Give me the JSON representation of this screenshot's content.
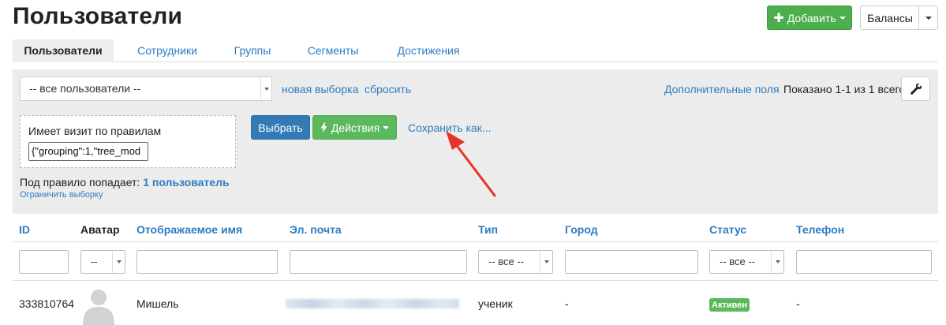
{
  "header": {
    "title": "Пользователи",
    "add_button": "Добавить",
    "balance_button": "Балансы"
  },
  "tabs": [
    {
      "label": "Пользователи",
      "active": true
    },
    {
      "label": "Сотрудники"
    },
    {
      "label": "Группы"
    },
    {
      "label": "Сегменты"
    },
    {
      "label": "Достижения"
    }
  ],
  "filter": {
    "selection_value": "-- все пользователи --",
    "new_selection_link": "новая выборка",
    "reset_link": "сбросить",
    "extra_fields_link": "Дополнительные поля",
    "shown_text": "Показано 1-1 из 1 всего.",
    "rule_label": "Имеет визит по правилам",
    "rule_value": "{\"grouping\":1,\"tree_mod",
    "choose_button": "Выбрать",
    "actions_button": "Действия",
    "save_as_link": "Сохранить как...",
    "result_prefix": "Под правило попадает:",
    "result_count": "1 пользователь",
    "limit_link": "Ограничить выборку"
  },
  "table": {
    "columns": [
      "ID",
      "Аватар",
      "Отображаемое имя",
      "Эл. почта",
      "Тип",
      "Город",
      "Статус",
      "Телефон"
    ],
    "filters": {
      "avatar_select": "--",
      "type_select": "-- все --",
      "status_select": "-- все --"
    },
    "rows": [
      {
        "id": "333810764",
        "name": "Мишель",
        "type": "ученик",
        "city": "-",
        "status": "Активен",
        "phone": "-"
      }
    ]
  },
  "colors": {
    "link": "#2d7cc1",
    "primary": "#337ab7",
    "success": "#5cb85c",
    "arrow": "#e5332a",
    "panel": "#ececec"
  },
  "icons": [
    "plus-icon",
    "caret-down-icon",
    "wrench-icon",
    "bolt-icon",
    "avatar-placeholder-icon",
    "annotation-arrow"
  ]
}
